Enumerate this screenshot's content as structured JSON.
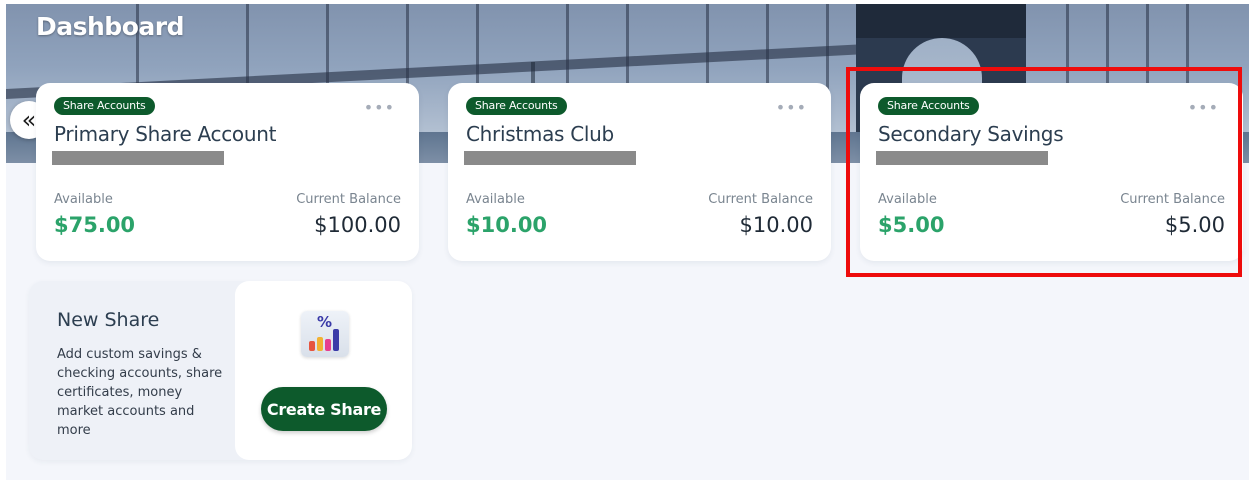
{
  "header": {
    "title": "Dashboard",
    "collapse_icon": "«"
  },
  "accounts": [
    {
      "badge": "Share Accounts",
      "name": "Primary Share Account",
      "available_label": "Available",
      "available": "$75.00",
      "balance_label": "Current Balance",
      "balance": "$100.00"
    },
    {
      "badge": "Share Accounts",
      "name": "Christmas Club",
      "available_label": "Available",
      "available": "$10.00",
      "balance_label": "Current Balance",
      "balance": "$10.00"
    },
    {
      "badge": "Share Accounts",
      "name": "Secondary Savings",
      "available_label": "Available",
      "available": "$5.00",
      "balance_label": "Current Balance",
      "balance": "$5.00"
    }
  ],
  "more_icon": "•••",
  "new_share": {
    "title": "New Share",
    "description": "Add custom savings & checking accounts, share certificates, money market accounts and more",
    "icon_label": "%",
    "button_label": "Create Share"
  },
  "colors": {
    "brand_green": "#0d5a2c",
    "available_green": "#2ba36a",
    "highlight_red": "#ee0c0c"
  }
}
